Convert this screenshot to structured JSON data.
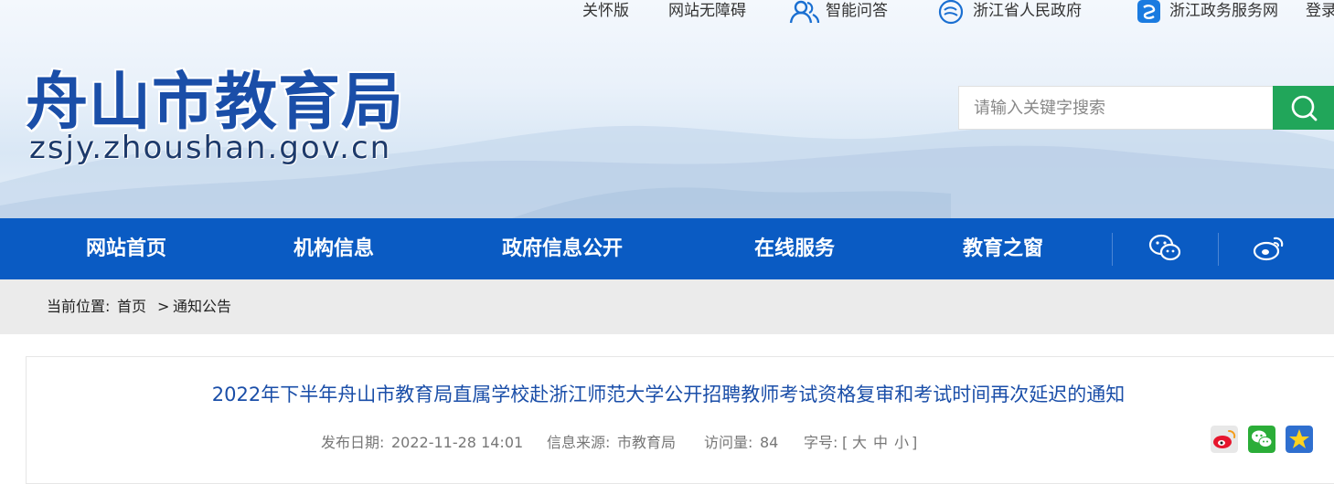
{
  "toplinks": {
    "care": "关怀版",
    "accessible": "网站无障碍",
    "qa": "智能问答",
    "zj_gov": "浙江省人民政府",
    "zj_service": "浙江政务服务网",
    "login": "登录"
  },
  "logo": {
    "name_cn": "舟山市教育局",
    "domain": "zsjy.zhoushan.gov.cn"
  },
  "search": {
    "placeholder": "请输入关键字搜索",
    "button_icon": "search-icon"
  },
  "nav": {
    "items": [
      "网站首页",
      "机构信息",
      "政府信息公开",
      "在线服务",
      "教育之窗"
    ],
    "icons": [
      "wechat-icon",
      "weibo-icon"
    ]
  },
  "breadcrumb": {
    "label": "当前位置:",
    "home": "首页",
    "sep": ">",
    "current": "通知公告"
  },
  "article": {
    "title": "2022年下半年舟山市教育局直属学校赴浙江师范大学公开招聘教师考试资格复审和考试时间再次延迟的通知",
    "date_label": "发布日期:",
    "date": "2022-11-28 14:01",
    "source_label": "信息来源:",
    "source": "市教育局",
    "views_label": "访问量:",
    "views": "84",
    "size_label": "字号:",
    "size_open": "[",
    "size_large": "大",
    "size_medium": "中",
    "size_small": "小",
    "size_close": "]",
    "share_icons": [
      "weibo-share-icon",
      "wechat-share-icon",
      "favorite-star-icon"
    ]
  },
  "colors": {
    "brand_blue": "#0a5bc3",
    "logo_blue": "#1a4ea8",
    "search_green": "#21a65a",
    "breadcrumb_bg": "#ebebeb"
  }
}
